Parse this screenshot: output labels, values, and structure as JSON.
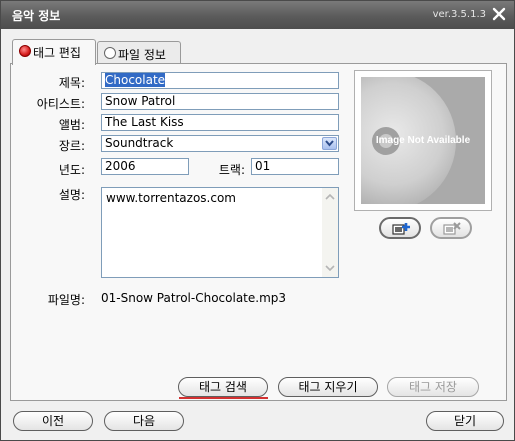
{
  "window": {
    "title": "음악 정보",
    "version": "ver.3.5.1.3"
  },
  "tabs": [
    {
      "label": "태그 편집",
      "active": true
    },
    {
      "label": "파일 정보",
      "active": false
    }
  ],
  "form": {
    "title_label": "제목:",
    "title_value": "Chocolate",
    "artist_label": "아티스트:",
    "artist_value": "Snow Patrol",
    "album_label": "앨범:",
    "album_value": "The Last Kiss",
    "genre_label": "장르:",
    "genre_value": "Soundtrack",
    "year_label": "년도:",
    "year_value": "2006",
    "track_label": "트랙:",
    "track_value": "01",
    "comment_label": "설명:",
    "comment_value": "www.torrentazos.com",
    "filename_label": "파일명:",
    "filename_value": "01-Snow Patrol-Chocolate.mp3"
  },
  "album_art": {
    "placeholder_text": "Image Not Available"
  },
  "buttons": {
    "search_tag": "태그 검색",
    "clear_tag": "태그 지우기",
    "save_tag": "태그 저장",
    "prev": "이전",
    "next": "다음",
    "close": "닫기"
  },
  "colors": {
    "titlebar": "#5b5b5b",
    "selection": "#316ac5",
    "field_border": "#7f9db9",
    "active_radio": "#d61c1c"
  }
}
